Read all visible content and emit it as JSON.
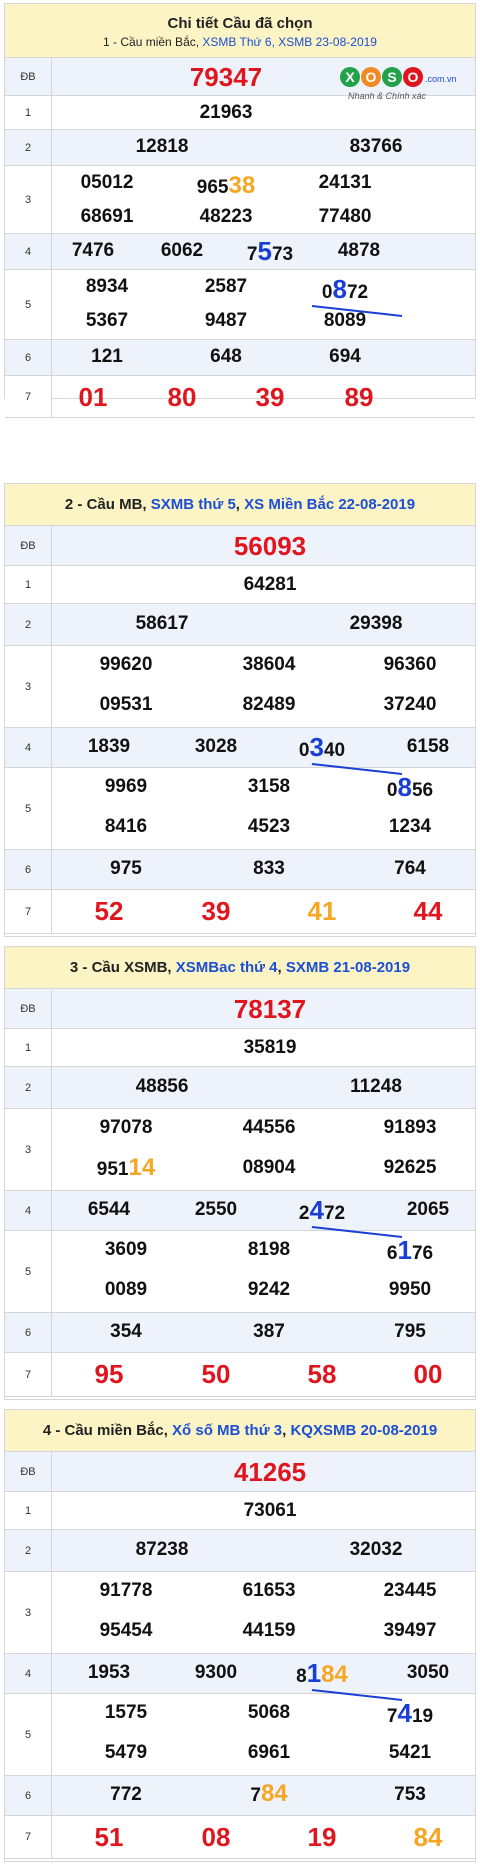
{
  "sections": [
    {
      "title": "Chi tiết Cầu đã chọn",
      "subtitle_prefix": "1 - Cầu miền Bắc, ",
      "subtitle_link": "XSMB Thứ 6, XSMB 23-08-2019",
      "labels": [
        "ĐB",
        "1",
        "2",
        "3",
        "4",
        "5",
        "6",
        "7"
      ],
      "db": "79347",
      "g1": "21963",
      "g2": [
        "12818",
        "83766"
      ],
      "g3": [
        [
          "05012",
          "965",
          "38",
          "24131"
        ],
        [
          "68691",
          "48223",
          "77480"
        ]
      ],
      "g4": [
        "7476",
        "6062",
        "7",
        "5",
        "73",
        "4878"
      ],
      "g5": [
        [
          "8934",
          "2587",
          "0",
          "8",
          "72"
        ],
        [
          "5367",
          "9487",
          "8089"
        ]
      ],
      "g6": [
        "121",
        "648",
        "694"
      ],
      "g7": [
        "01",
        "80",
        "39",
        "89"
      ]
    },
    {
      "title_prefix": "2 - Cầu MB, ",
      "title_link1": "SXMB thứ 5",
      "title_sep": ", ",
      "title_link2": "XS Miền Bắc 22-08-2019",
      "labels": [
        "ĐB",
        "1",
        "2",
        "3",
        "4",
        "5",
        "6",
        "7"
      ],
      "db": "56093",
      "g1": "64281",
      "g2": [
        "58617",
        "29398"
      ],
      "g3": [
        [
          "99620",
          "38604",
          "96360"
        ],
        [
          "09531",
          "82489",
          "37240"
        ]
      ],
      "g4": [
        "1839",
        "3028",
        "0",
        "3",
        "40",
        "6158"
      ],
      "g5": [
        [
          "9969",
          "3158",
          "0",
          "8",
          "56"
        ],
        [
          "8416",
          "4523",
          "1234"
        ]
      ],
      "g6": [
        "975",
        "833",
        "764"
      ],
      "g7": [
        "52",
        "39",
        "41",
        "44"
      ]
    },
    {
      "title_prefix": "3 - Cầu XSMB, ",
      "title_link1": "XSMBac thứ 4",
      "title_sep": ", ",
      "title_link2": "SXMB 21-08-2019",
      "labels": [
        "ĐB",
        "1",
        "2",
        "3",
        "4",
        "5",
        "6",
        "7"
      ],
      "db": "78137",
      "g1": "35819",
      "g2": [
        "48856",
        "11248"
      ],
      "g3": [
        [
          "97078",
          "44556",
          "91893"
        ],
        [
          "951",
          "14",
          "08904",
          "92625"
        ]
      ],
      "g4": [
        "6544",
        "2550",
        "2",
        "4",
        "72",
        "2065"
      ],
      "g5": [
        [
          "3609",
          "8198",
          "6",
          "1",
          "76"
        ],
        [
          "0089",
          "9242",
          "9950"
        ]
      ],
      "g6": [
        "354",
        "387",
        "795"
      ],
      "g7": [
        "95",
        "50",
        "58",
        "00"
      ]
    },
    {
      "title_prefix": "4 - Cầu miền Bắc, ",
      "title_link1": "Xổ số MB thứ 3",
      "title_sep": ", ",
      "title_link2": "KQXSMB 20-08-2019",
      "labels": [
        "ĐB",
        "1",
        "2",
        "3",
        "4",
        "5",
        "6",
        "7"
      ],
      "db": "41265",
      "g1": "73061",
      "g2": [
        "87238",
        "32032"
      ],
      "g3": [
        [
          "91778",
          "61653",
          "23445"
        ],
        [
          "95454",
          "44159",
          "39497"
        ]
      ],
      "g4": [
        "1953",
        "9300",
        "8",
        "1",
        "84",
        "3050"
      ],
      "g5": [
        [
          "1575",
          "5068",
          "7",
          "4",
          "19"
        ],
        [
          "5479",
          "6961",
          "5421"
        ]
      ],
      "g6": [
        "772",
        "7",
        "84",
        "753"
      ],
      "g7": [
        "51",
        "08",
        "19",
        "84"
      ]
    }
  ],
  "logo": {
    "brand": "XOSO",
    "domain": ".com.vn",
    "tagline": "Nhanh & Chính xác"
  },
  "colors": {
    "header_bg": "#fcf4c4",
    "row_alt": "#eef2fb",
    "red": "#e0161f",
    "blue": "#1a3fd6",
    "orange": "#f5a623"
  }
}
